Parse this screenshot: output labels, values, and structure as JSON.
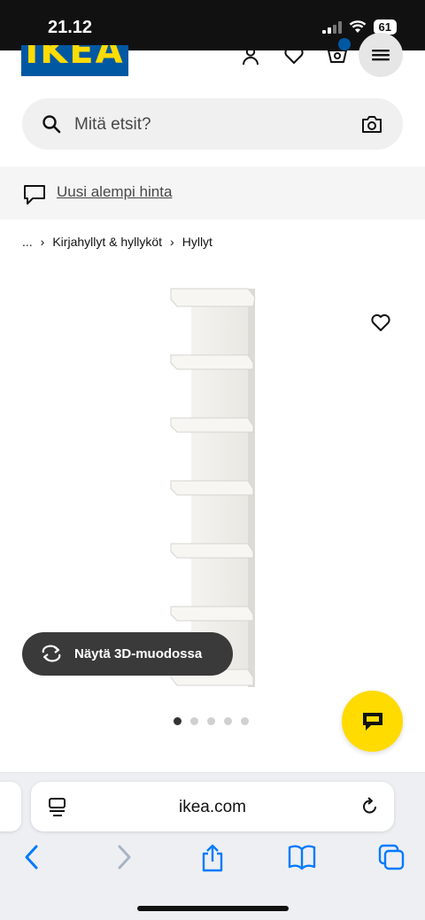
{
  "status_bar": {
    "time": "21.12",
    "battery": "61"
  },
  "header": {
    "logo_text": "IKEA"
  },
  "search": {
    "placeholder": "Mitä etsit?"
  },
  "promo": {
    "text": "Uusi alempi hinta"
  },
  "breadcrumb": {
    "ellipsis": "...",
    "items": [
      "Kirjahyllyt & hyllyköt",
      "Hyllyt"
    ]
  },
  "product": {
    "view_3d_label": "Näytä 3D-muodossa",
    "image_count": 5,
    "active_image_index": 0
  },
  "browser": {
    "url": "ikea.com"
  },
  "colors": {
    "ikea_blue": "#0058a3",
    "ikea_yellow": "#ffdb00",
    "safari_blue": "#007aff"
  }
}
